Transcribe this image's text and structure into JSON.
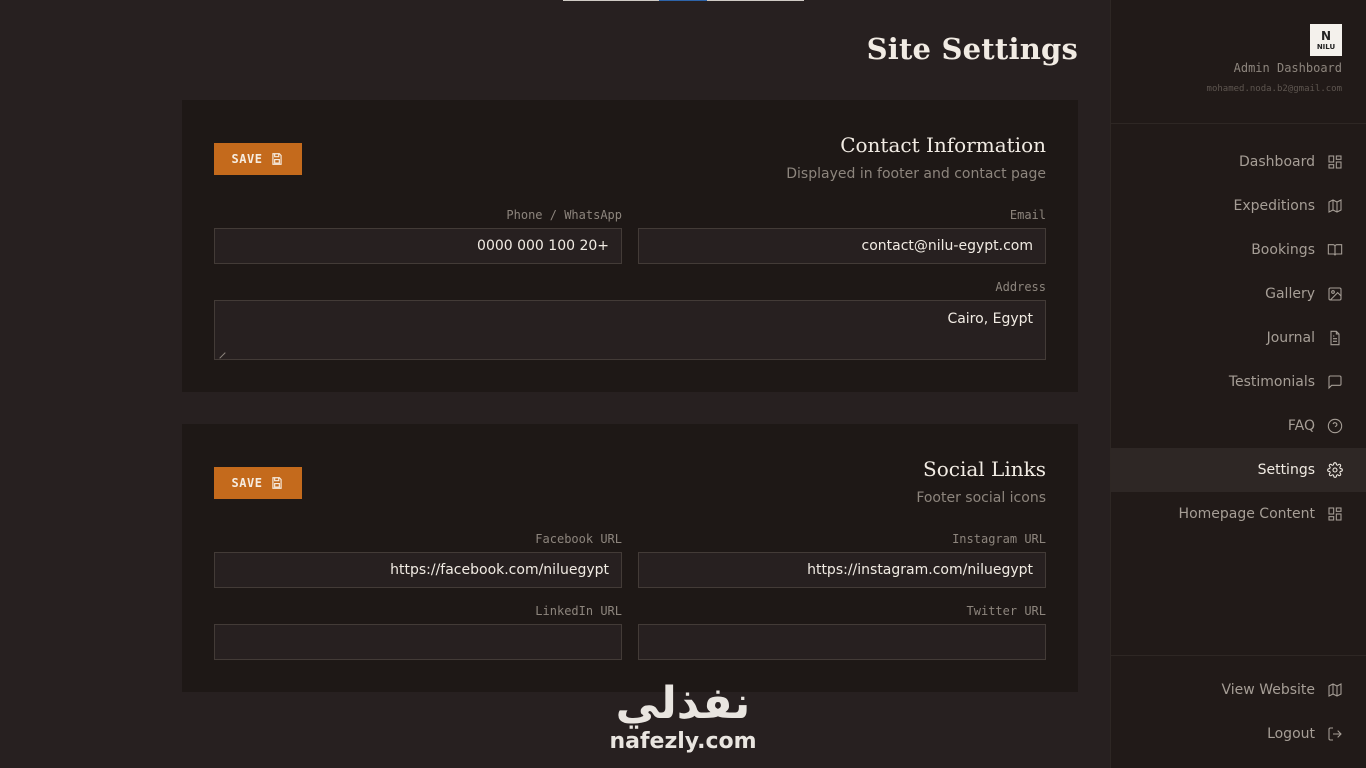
{
  "page": {
    "title": "Site Settings"
  },
  "contact": {
    "title": "Contact Information",
    "subtitle": "Displayed in footer and contact page",
    "save_label": "SAVE",
    "phone_label": "Phone / WhatsApp",
    "phone_value": "0000 000 100 20+",
    "email_label": "Email",
    "email_value": "contact@nilu-egypt.com",
    "address_label": "Address",
    "address_value": "Cairo, Egypt"
  },
  "social": {
    "title": "Social Links",
    "subtitle": "Footer social icons",
    "save_label": "SAVE",
    "facebook_label": "Facebook URL",
    "facebook_value": "https://facebook.com/niluegypt",
    "instagram_label": "Instagram URL",
    "instagram_value": "https://instagram.com/niluegypt",
    "linkedin_label": "LinkedIn URL",
    "linkedin_value": "",
    "twitter_label": "Twitter URL",
    "twitter_value": ""
  },
  "sidebar": {
    "logo_text": "NILU",
    "admin_label": "Admin Dashboard",
    "admin_email": "mohamed.noda.b2@gmail.com",
    "items": [
      {
        "label": "Dashboard",
        "icon": "grid-icon"
      },
      {
        "label": "Expeditions",
        "icon": "map-icon"
      },
      {
        "label": "Bookings",
        "icon": "book-icon"
      },
      {
        "label": "Gallery",
        "icon": "image-icon"
      },
      {
        "label": "Journal",
        "icon": "file-icon"
      },
      {
        "label": "Testimonials",
        "icon": "message-icon"
      },
      {
        "label": "FAQ",
        "icon": "help-circle-icon"
      },
      {
        "label": "Settings",
        "icon": "gear-icon",
        "active": true
      },
      {
        "label": "Homepage Content",
        "icon": "grid-icon"
      }
    ],
    "bottom": [
      {
        "label": "View Website",
        "icon": "map-icon"
      },
      {
        "label": "Logout",
        "icon": "logout-icon"
      }
    ]
  },
  "watermark": {
    "arabic": "نفذلي",
    "latin": "nafezly.com"
  },
  "colors": {
    "accent": "#c46a1c",
    "background": "#272020",
    "card": "#1e1816",
    "sidebar": "#211a18"
  }
}
